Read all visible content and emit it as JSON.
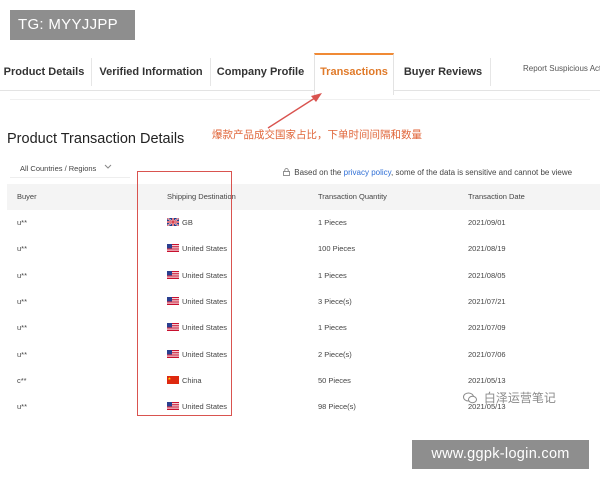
{
  "badges": {
    "tg": "TG: MYYJJPP",
    "url": "www.ggpk-login.com"
  },
  "tabs": [
    {
      "label": "Product Details",
      "active": false
    },
    {
      "label": "Verified Information",
      "active": false
    },
    {
      "label": "Company Profile",
      "active": false
    },
    {
      "label": "Transactions",
      "active": true
    },
    {
      "label": "Buyer Reviews",
      "active": false
    }
  ],
  "report_link": "Report Suspicious Acti",
  "page": {
    "title": "Product Transaction Details",
    "annotation": "爆款产品成交国家占比，下单时间间隔和数量"
  },
  "filter": {
    "country_select": "All Countries / Regions"
  },
  "privacy": {
    "prefix": "Based on the",
    "link": "privacy policy",
    "suffix": ", some of the data is sensitive and cannot be viewe"
  },
  "table": {
    "headers": [
      "Buyer",
      "Shipping Destination",
      "Transaction Quantity",
      "Transaction Date"
    ],
    "rows": [
      {
        "buyer": "u**",
        "flag": "gb",
        "destination": "GB",
        "quantity": "1 Pieces",
        "date": "2021/09/01"
      },
      {
        "buyer": "u**",
        "flag": "us",
        "destination": "United States",
        "quantity": "100 Pieces",
        "date": "2021/08/19"
      },
      {
        "buyer": "u**",
        "flag": "us",
        "destination": "United States",
        "quantity": "1 Pieces",
        "date": "2021/08/05"
      },
      {
        "buyer": "u**",
        "flag": "us",
        "destination": "United States",
        "quantity": "3 Piece(s)",
        "date": "2021/07/21"
      },
      {
        "buyer": "u**",
        "flag": "us",
        "destination": "United States",
        "quantity": "1 Pieces",
        "date": "2021/07/09"
      },
      {
        "buyer": "u**",
        "flag": "us",
        "destination": "United States",
        "quantity": "2 Piece(s)",
        "date": "2021/07/06"
      },
      {
        "buyer": "c**",
        "flag": "cn",
        "destination": "China",
        "quantity": "50 Pieces",
        "date": "2021/05/13"
      },
      {
        "buyer": "u**",
        "flag": "us",
        "destination": "United States",
        "quantity": "98 Piece(s)",
        "date": "2021/05/13"
      }
    ]
  },
  "watermark": {
    "wechat": "白泽运营笔记"
  },
  "colors": {
    "accent_tab": "#f08a35",
    "annotation": "#e0663a",
    "highlight_box": "#d9534f",
    "link": "#2f6fd6"
  }
}
